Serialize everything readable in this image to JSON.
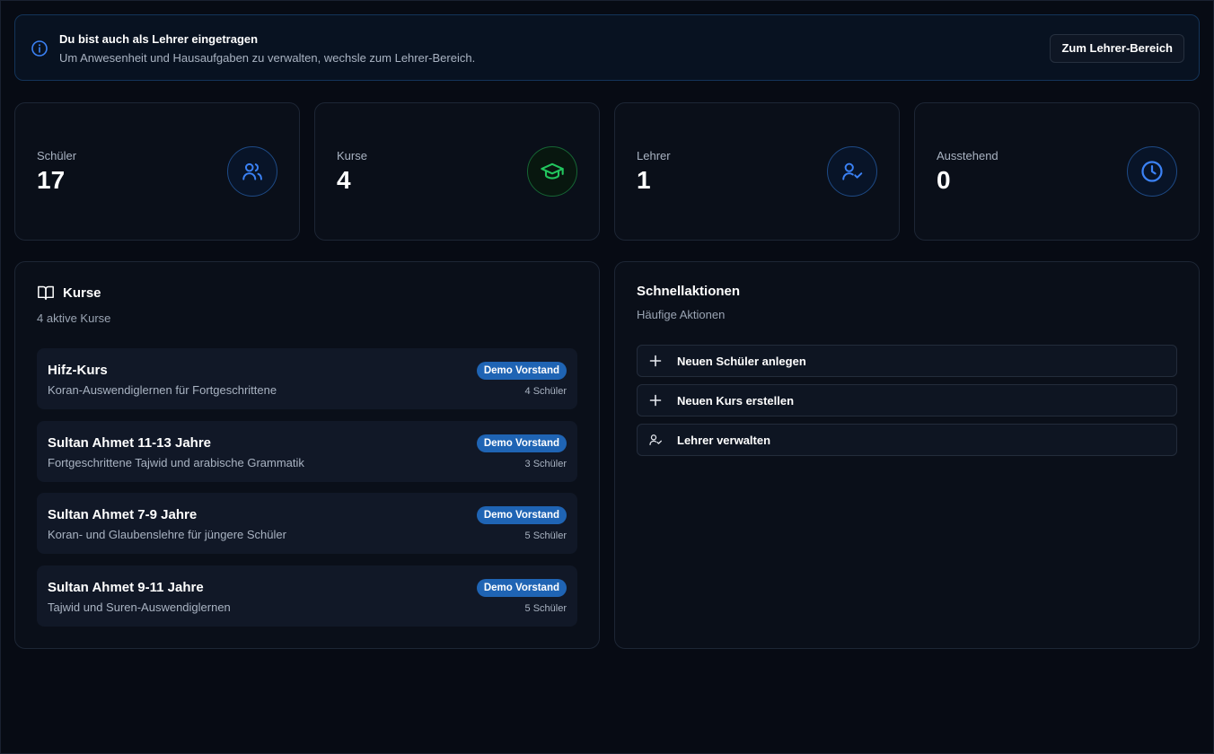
{
  "banner": {
    "title": "Du bist auch als Lehrer eingetragen",
    "text": "Um Anwesenheit und Hausaufgaben zu verwalten, wechsle zum Lehrer-Bereich.",
    "button": "Zum Lehrer-Bereich"
  },
  "stats": [
    {
      "label": "Schüler",
      "value": "17",
      "icon": "users-icon",
      "color": "#3b82f6"
    },
    {
      "label": "Kurse",
      "value": "4",
      "icon": "graduation-cap-icon",
      "color": "#22c55e"
    },
    {
      "label": "Lehrer",
      "value": "1",
      "icon": "user-check-icon",
      "color": "#3b82f6"
    },
    {
      "label": "Ausstehend",
      "value": "0",
      "icon": "clock-icon",
      "color": "#3b82f6"
    }
  ],
  "courses_panel": {
    "title": "Kurse",
    "subtitle": "4 aktive Kurse",
    "icon": "book-open-icon",
    "items": [
      {
        "name": "Hifz-Kurs",
        "description": "Koran-Auswendiglernen für Fortgeschrittene",
        "badge": "Demo Vorstand",
        "count": "4 Schüler"
      },
      {
        "name": "Sultan Ahmet 11-13 Jahre",
        "description": "Fortgeschrittene Tajwid und arabische Grammatik",
        "badge": "Demo Vorstand",
        "count": "3 Schüler"
      },
      {
        "name": "Sultan Ahmet 7-9 Jahre",
        "description": "Koran- und Glaubenslehre für jüngere Schüler",
        "badge": "Demo Vorstand",
        "count": "5 Schüler"
      },
      {
        "name": "Sultan Ahmet 9-11 Jahre",
        "description": "Tajwid und Suren-Auswendiglernen",
        "badge": "Demo Vorstand",
        "count": "5 Schüler"
      }
    ]
  },
  "quick_actions": {
    "title": "Schnellaktionen",
    "subtitle": "Häufige Aktionen",
    "items": [
      {
        "label": "Neuen Schüler anlegen",
        "icon": "plus-icon"
      },
      {
        "label": "Neuen Kurs erstellen",
        "icon": "plus-icon"
      },
      {
        "label": "Lehrer verwalten",
        "icon": "user-check-icon"
      }
    ]
  },
  "colors": {
    "accent": "#1f64b4",
    "background": "#070b14",
    "success": "#22c55e"
  }
}
